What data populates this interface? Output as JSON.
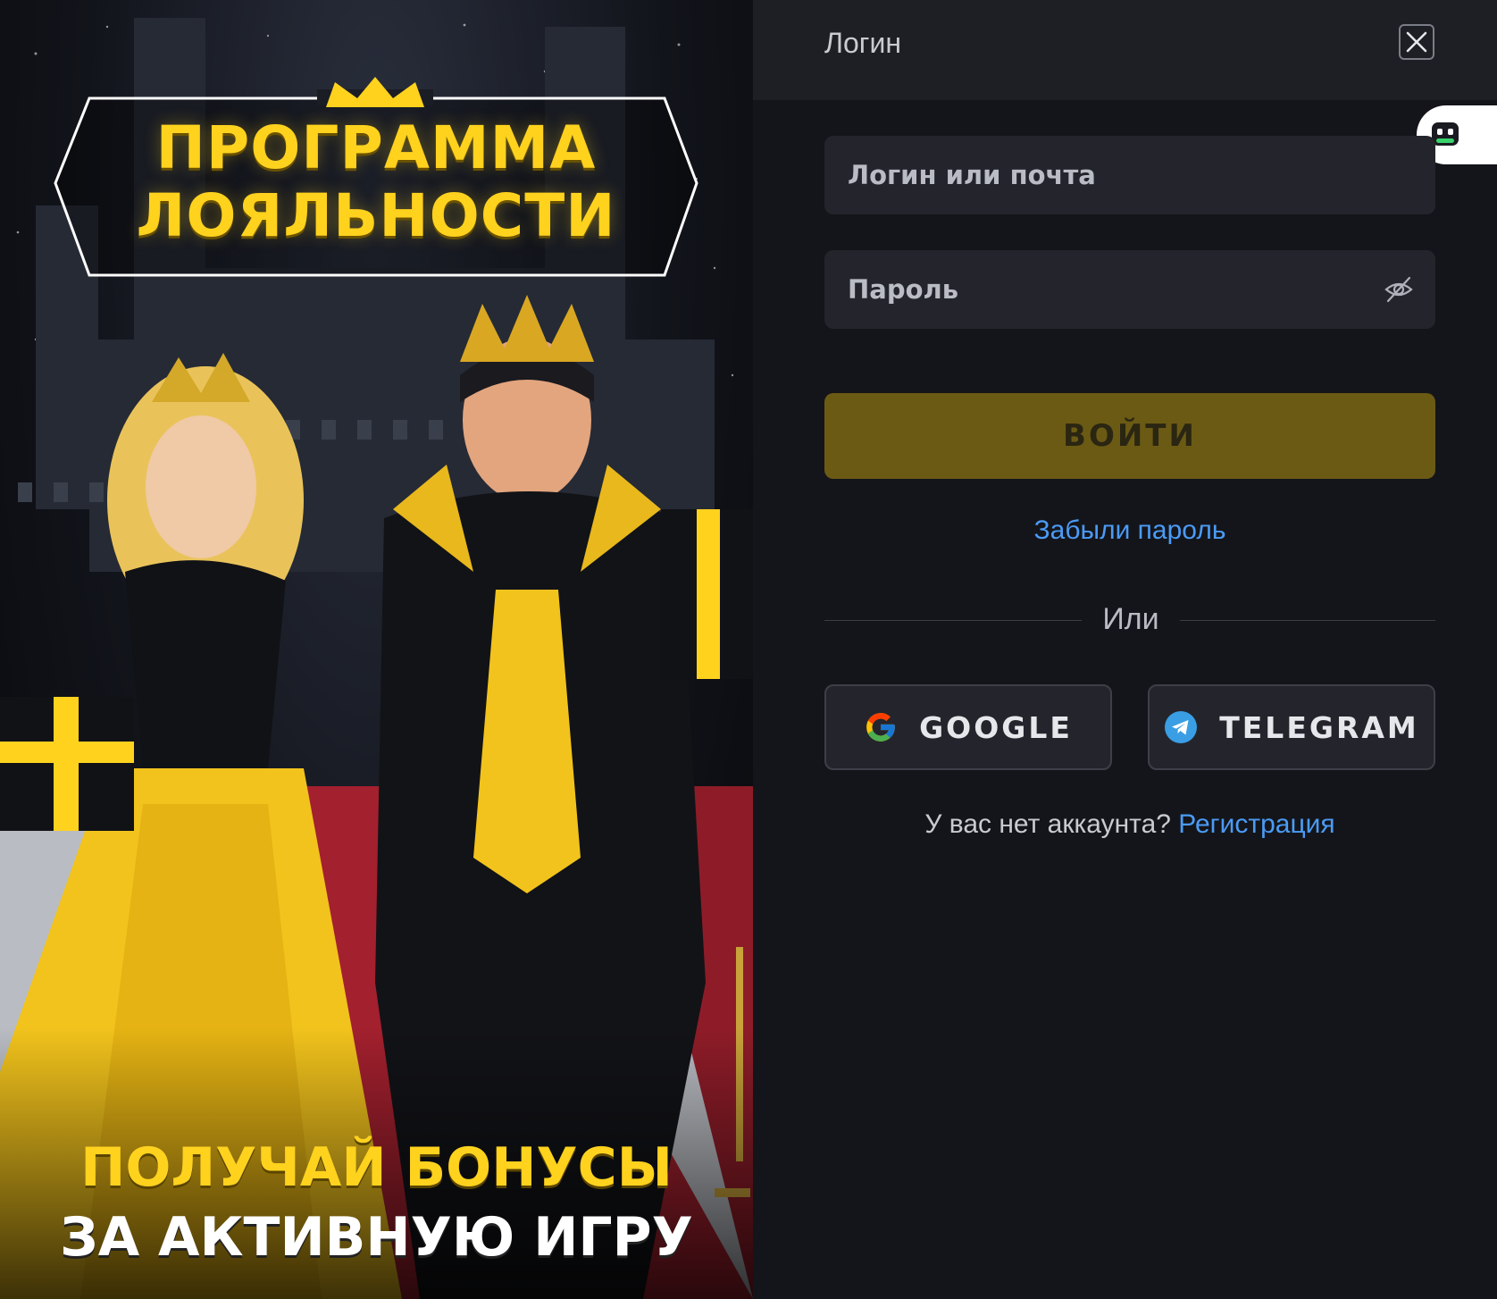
{
  "promo": {
    "title_line1": "ПРОГРАММА",
    "title_line2": "ЛОЯЛЬНОСТИ",
    "bottom_line1": "ПОЛУЧАЙ БОНУСЫ",
    "bottom_line2": "ЗА АКТИВНУЮ ИГРУ",
    "accent_color": "#ffd21e"
  },
  "header": {
    "title": "Логин",
    "close_icon": "close-icon"
  },
  "form": {
    "login_placeholder": "Логин или почта",
    "password_placeholder": "Пароль",
    "password_toggle_icon": "eye-off-icon",
    "submit_label": "ВОЙТИ",
    "forgot_label": "Забыли пароль",
    "divider_label": "Или"
  },
  "social": {
    "google_label": "GOOGLE",
    "telegram_label": "TELEGRAM"
  },
  "register": {
    "question": "У вас нет аккаунта?",
    "link": "Регистрация"
  },
  "colors": {
    "panel_bg": "#14151a",
    "header_bg": "#1e1f25",
    "field_bg": "#24252c",
    "submit_bg": "#6b5a14",
    "link": "#4b9bf5"
  }
}
